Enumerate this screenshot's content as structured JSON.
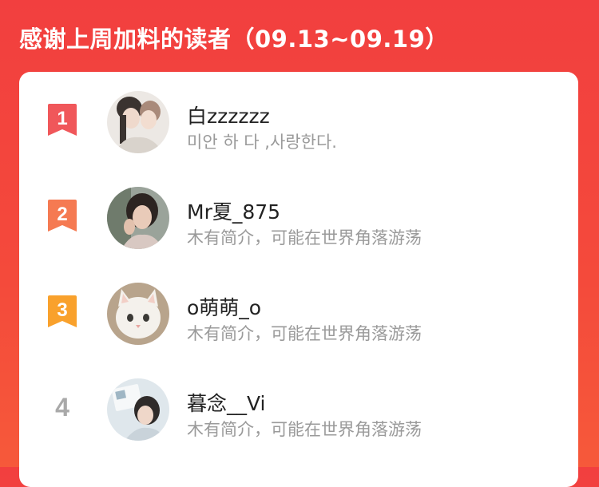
{
  "header": {
    "title": "感谢上周加料的读者（09.13~09.19）"
  },
  "colors": {
    "rank1": "#f0575a",
    "rank2": "#f57a52",
    "rank3": "#f9a12c",
    "rank_plain": "#a9a9a9"
  },
  "readers": [
    {
      "rank": "1",
      "name": "白zzzzzz",
      "bio": "미안 하 다 ,사랑한다.",
      "avatar_icon": "two-girls-avatar"
    },
    {
      "rank": "2",
      "name": "Mr夏_875",
      "bio": "木有简介，可能在世界角落游荡",
      "avatar_icon": "girl-portrait-avatar"
    },
    {
      "rank": "3",
      "name": "o萌萌_o",
      "bio": "木有简介，可能在世界角落游荡",
      "avatar_icon": "white-cat-avatar"
    },
    {
      "rank": "4",
      "name": "暮念__Vi",
      "bio": "木有简介，可能在世界角落游荡",
      "avatar_icon": "girl-reading-avatar"
    }
  ]
}
